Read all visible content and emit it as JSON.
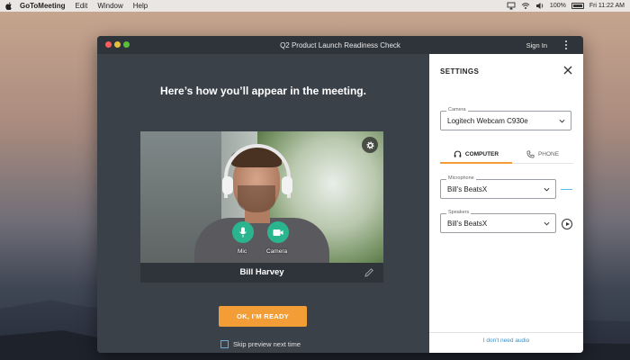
{
  "menubar": {
    "app_name": "GoToMeeting",
    "items": [
      "Edit",
      "Window",
      "Help"
    ],
    "battery_text": "100%",
    "clock": "Fri 11:22 AM"
  },
  "window": {
    "title": "Q2 Product Launch Readiness Check",
    "signin_label": "Sign In"
  },
  "preview": {
    "headline": "Here’s how you’ll appear in the meeting.",
    "mic_label": "Mic",
    "camera_label": "Camera",
    "participant_name": "Bill Harvey",
    "ready_button": "OK, I’M READY",
    "skip_label": "Skip preview next time"
  },
  "settings": {
    "title": "SETTINGS",
    "camera_label": "Camera",
    "camera_value": "Logitech Webcam C930e",
    "tab_computer": "COMPUTER",
    "tab_phone": "PHONE",
    "microphone_label": "Microphone",
    "microphone_value": "Bill's BeatsX",
    "speakers_label": "Speakers",
    "speakers_value": "Bill's BeatsX",
    "no_audio_link": "I don't need audio"
  },
  "colors": {
    "accent_orange": "#f39d37",
    "av_green": "#2bb58f",
    "link_blue": "#3a8fc8",
    "meter_cyan": "#4fc3e8"
  }
}
